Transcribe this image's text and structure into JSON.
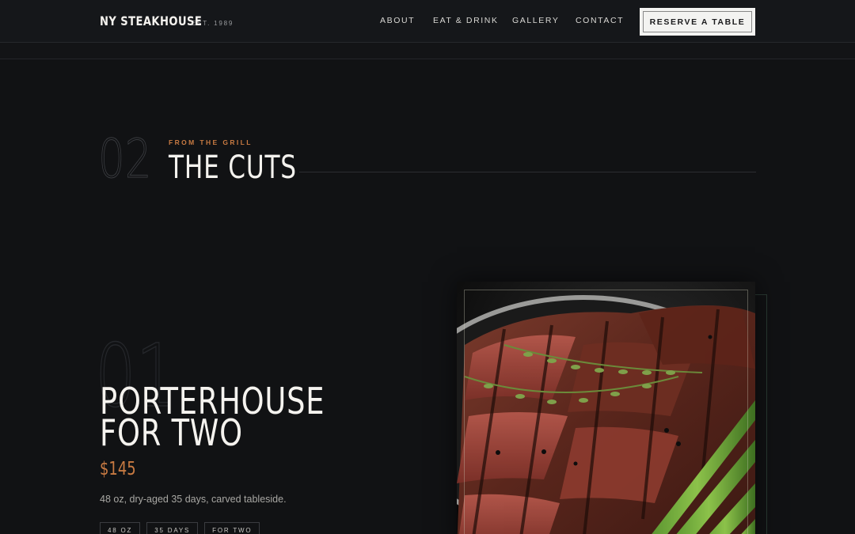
{
  "header": {
    "brand": "NY STEAKHOUSE",
    "est": "EST. 1989",
    "nav": [
      "ABOUT",
      "EAT & DRINK",
      "GALLERY",
      "CONTACT"
    ],
    "cta": "RESERVE A TABLE"
  },
  "section": {
    "number": "02",
    "eyebrow": "FROM THE GRILL",
    "title": "THE CUTS"
  },
  "item": {
    "number": "01",
    "title_line1": "PORTERHOUSE",
    "title_line2": "FOR TWO",
    "price": "$145",
    "description": "48 oz, dry-aged 35 days, carved tableside.",
    "tags": [
      "48 OZ",
      "35 DAYS",
      "FOR TWO"
    ],
    "image": "grilled-steak-photo"
  },
  "colors": {
    "background": "#111214",
    "accent": "#c87a42",
    "text": "#f4f2ee"
  }
}
